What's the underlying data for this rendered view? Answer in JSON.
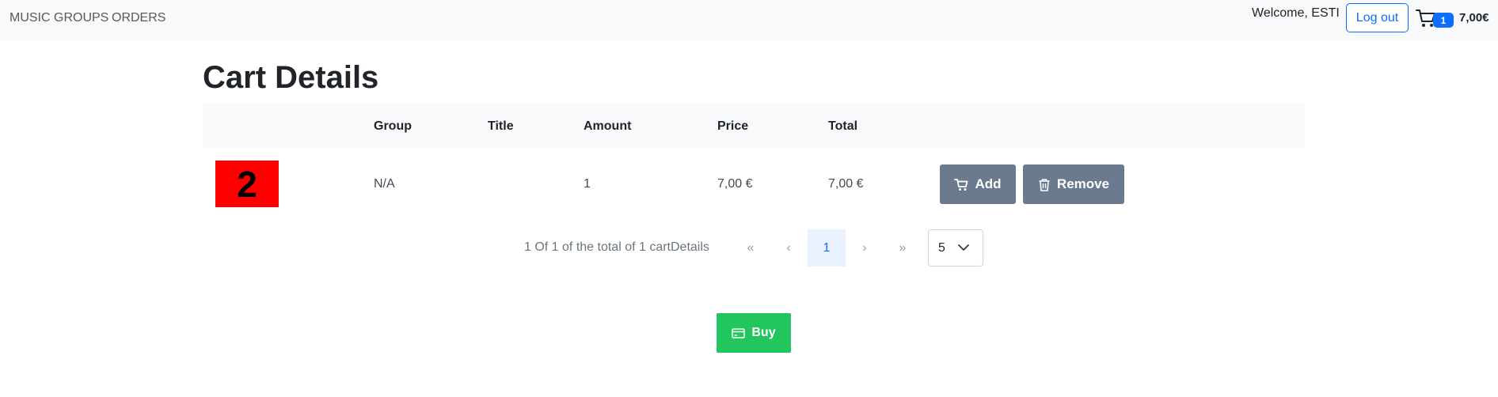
{
  "nav": {
    "links": [
      "MUSIC GROUPS",
      "ORDERS"
    ],
    "welcome": "Welcome, ESTI",
    "logout_label": "Log out",
    "cart_count": "1",
    "cart_total": "7,00€"
  },
  "page": {
    "title": "Cart Details"
  },
  "table": {
    "headers": [
      "Group",
      "Title",
      "Amount",
      "Price",
      "Total"
    ],
    "rows": [
      {
        "image_text": "2",
        "group": "N/A",
        "title": "",
        "amount": "1",
        "price": "7,00 €",
        "total": "7,00 €",
        "add_label": "Add",
        "remove_label": "Remove"
      }
    ]
  },
  "pagination": {
    "summary": "1 Of 1 of the total of 1 cartDetails",
    "first": "«",
    "prev": "‹",
    "current": "1",
    "next": "›",
    "last": "»",
    "page_size": "5"
  },
  "buy_label": "Buy",
  "colors": {
    "primary": "#0d6efd",
    "action_gray": "#6c7a8f",
    "buy_green": "#22c55e",
    "thumb_red": "#ff0000"
  }
}
